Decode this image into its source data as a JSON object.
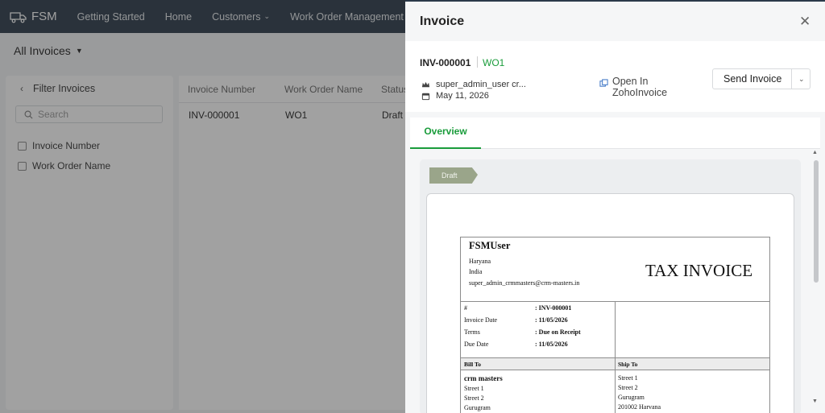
{
  "app": {
    "logo_text": "FSM",
    "nav": [
      {
        "label": "Getting Started",
        "has_dropdown": false
      },
      {
        "label": "Home",
        "has_dropdown": false
      },
      {
        "label": "Customers",
        "has_dropdown": true
      },
      {
        "label": "Work Order Management",
        "has_dropdown": true
      }
    ]
  },
  "list": {
    "view_title": "All Invoices",
    "filter": {
      "title": "Filter Invoices",
      "search_placeholder": "Search",
      "options": [
        "Invoice Number",
        "Work Order Name"
      ]
    },
    "columns": [
      "Invoice Number",
      "Work Order Name",
      "Status"
    ],
    "rows": [
      {
        "invoice_number": "INV-000001",
        "work_order_name": "WO1",
        "status": "Draft"
      }
    ]
  },
  "drawer": {
    "title": "Invoice",
    "close_icon": "close-icon",
    "invoice_number": "INV-000001",
    "work_order": "WO1",
    "owner": "super_admin_user cr...",
    "date": "May 11, 2026",
    "open_in_line1": "Open In",
    "open_in_line2": "ZohoInvoice",
    "send_button": "Send Invoice",
    "tabs": [
      {
        "label": "Overview",
        "active": true
      }
    ],
    "status_ribbon": "Draft",
    "accent_color": "#1a9c3b"
  },
  "document": {
    "company": "FSMUser",
    "address_lines": [
      "Haryana",
      "India",
      "super_admin_crmmasters@crm-masters.in"
    ],
    "title": "TAX INVOICE",
    "details": [
      {
        "label": "#",
        "value": ": INV-000001"
      },
      {
        "label": "Invoice Date",
        "value": ": 11/05/2026"
      },
      {
        "label": "Terms",
        "value": ": Due on Receipt"
      },
      {
        "label": "Due Date",
        "value": ": 11/05/2026"
      }
    ],
    "bill_to_label": "Bill To",
    "ship_to_label": "Ship To",
    "bill_to": [
      "crm masters",
      "Street 1",
      "Street 2",
      "Gurugram"
    ],
    "ship_to": [
      "Street 1",
      "Street 2",
      "Gurugram",
      "201002 Harvana"
    ]
  }
}
